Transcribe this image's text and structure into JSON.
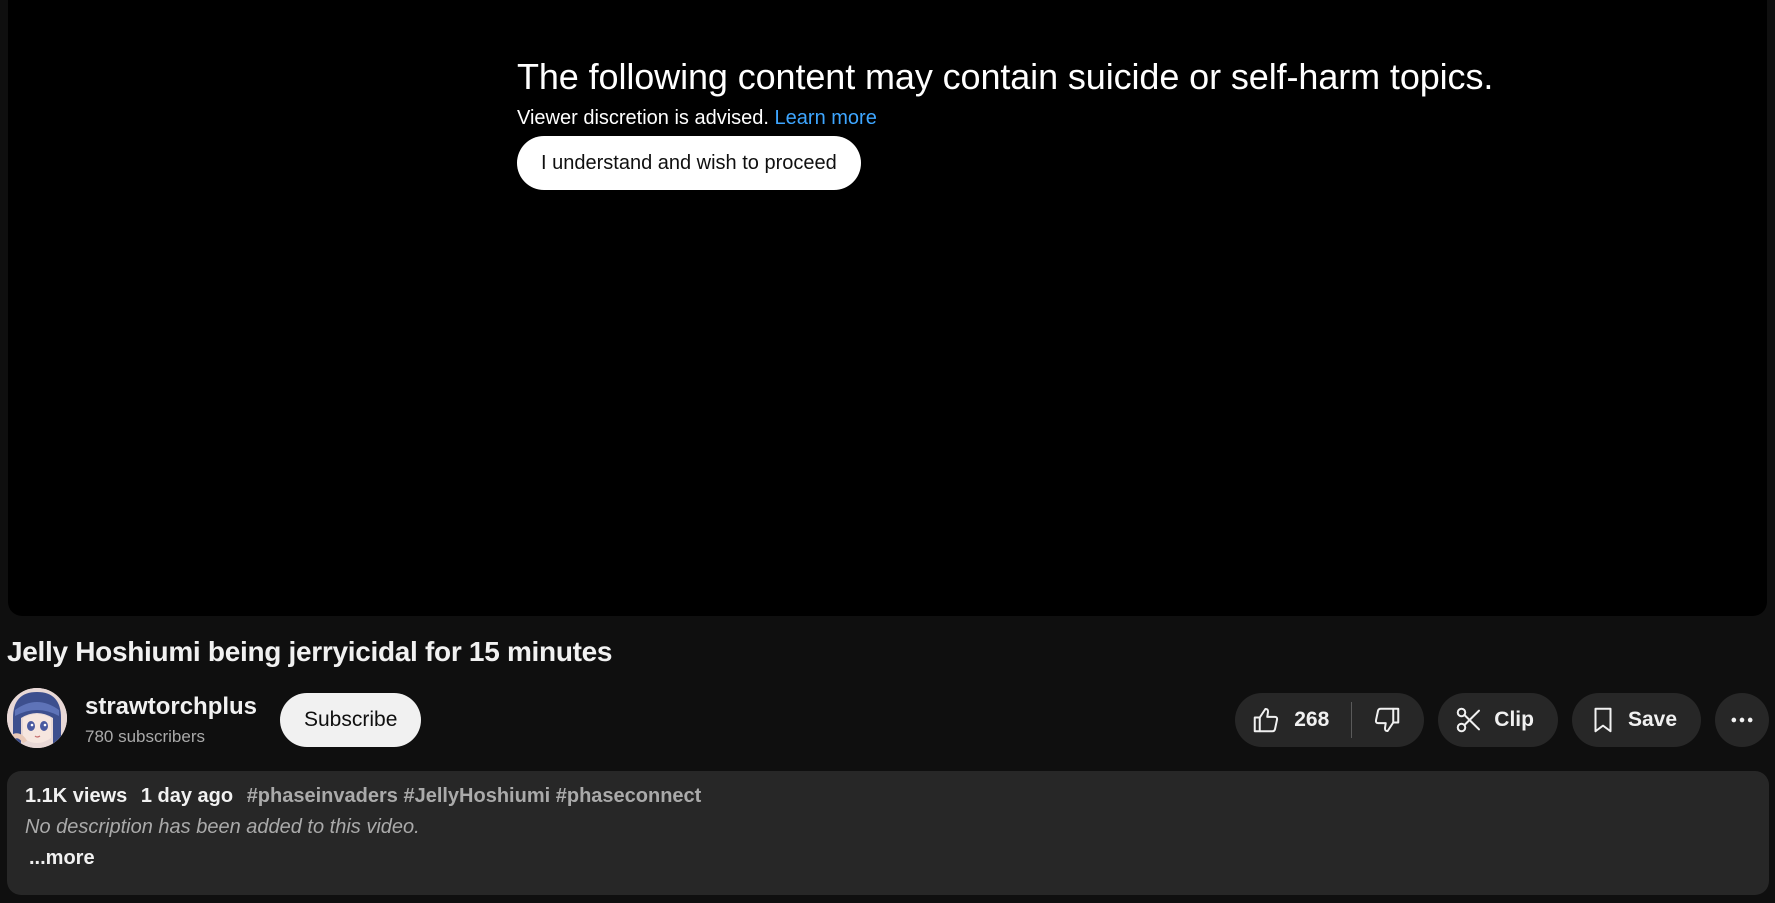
{
  "warning": {
    "title": "The following content may contain suicide or self-harm topics.",
    "subtitle": "Viewer discretion is advised.",
    "learn_more": "Learn more",
    "proceed_label": "I understand and wish to proceed"
  },
  "video": {
    "title": "Jelly Hoshiumi being jerryicidal for 15 minutes"
  },
  "channel": {
    "name": "strawtorchplus",
    "subscribers": "780 subscribers",
    "subscribe_label": "Subscribe"
  },
  "actions": {
    "likes": "268",
    "clip_label": "Clip",
    "save_label": "Save"
  },
  "description": {
    "views": "1.1K views",
    "date": "1 day ago",
    "tags": [
      "#phaseinvaders",
      "#JellyHoshiumi",
      "#phaseconnect"
    ],
    "empty_text": "No description has been added to this video.",
    "more_label": "...more"
  },
  "colors": {
    "background": "#0f0f0f",
    "player": "#000000",
    "surface": "#272727",
    "link": "#3ea6ff",
    "muted_text": "#aaaaaa"
  },
  "icons": [
    "thumbs-up-icon",
    "thumbs-down-icon",
    "scissors-icon",
    "bookmark-icon",
    "more-horizontal-icon"
  ]
}
